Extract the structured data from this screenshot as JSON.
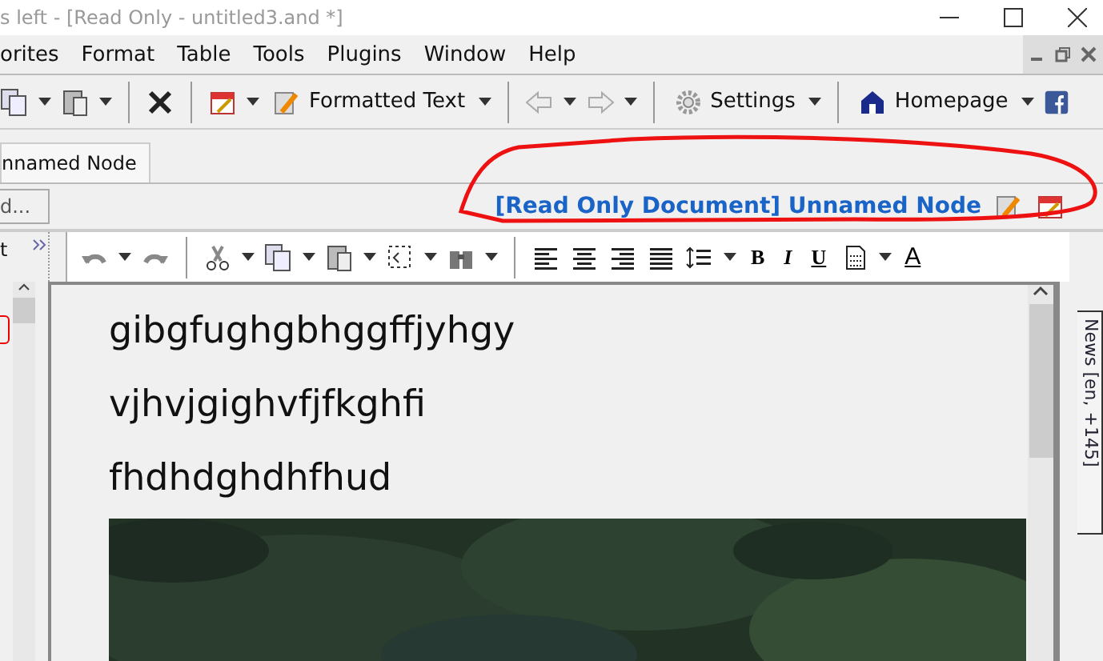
{
  "window": {
    "title": "s left - [Read Only - untitled3.and *]"
  },
  "menu": [
    "orites",
    "Format",
    "Table",
    "Tools",
    "Plugins",
    "Window",
    "Help"
  ],
  "toolbar_buttons": [
    {
      "label": "Formatted Text"
    },
    {
      "label": "Settings"
    },
    {
      "label": "Homepage"
    }
  ],
  "tabs": [
    {
      "label": "nnamed Node",
      "selected": true
    }
  ],
  "node_field": {
    "value": "d..."
  },
  "document_status": {
    "text": "[Read Only Document] Unnamed Node"
  },
  "left_panel": {
    "label": "t"
  },
  "format_buttons": [
    "B",
    "I",
    "U"
  ],
  "font_color_button": "A",
  "document": {
    "paragraphs": [
      "gibgfughgbhggffjyhgy",
      "vjhvjgighvfjfkghfi",
      "fhdhdghdhfhud"
    ]
  },
  "side_tab": {
    "label": "News [en, +145]"
  }
}
